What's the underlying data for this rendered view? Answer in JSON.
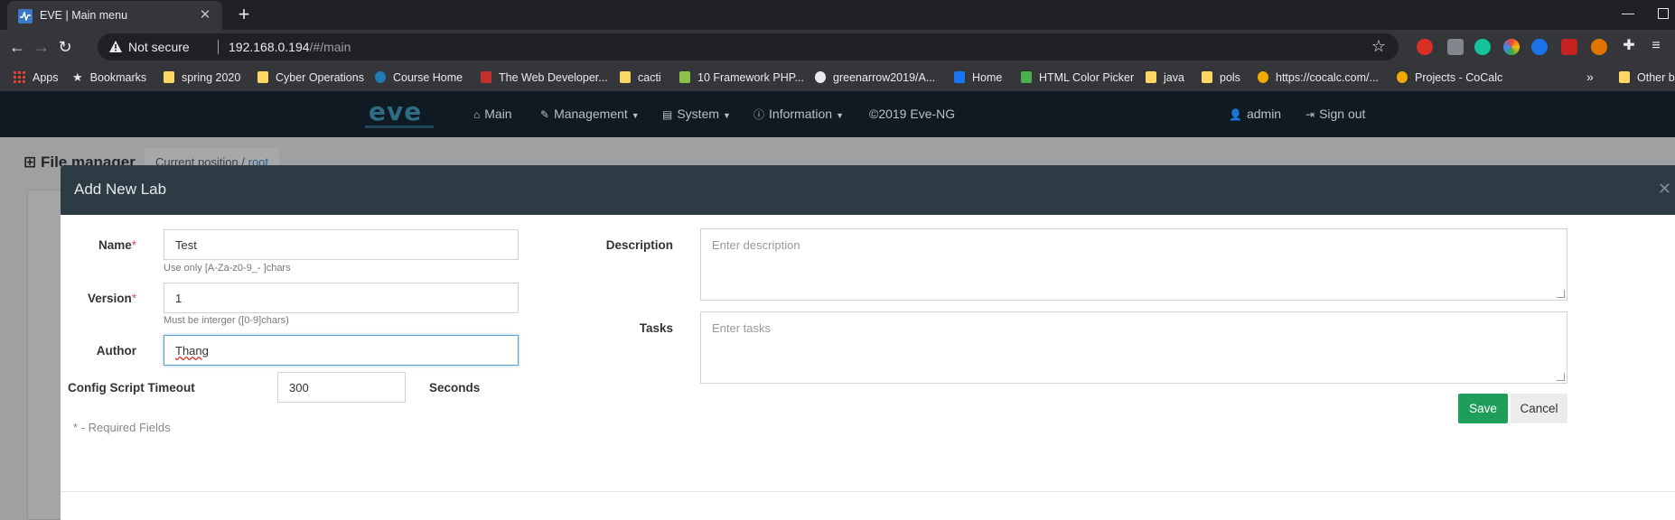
{
  "browser": {
    "tab_title": "EVE | Main menu",
    "tab_close": "✕",
    "new_tab": "+",
    "security_label": "Not secure",
    "url_host": "192.168.0.194",
    "url_path": "/#/main",
    "bookmarks": [
      {
        "label": "Apps",
        "icon": "apps-grid"
      },
      {
        "label": "Bookmarks",
        "icon": "star"
      },
      {
        "label": "spring 2020",
        "icon": "folder"
      },
      {
        "label": "Cyber Operations",
        "icon": "folder"
      },
      {
        "label": "Course Home",
        "icon": "site"
      },
      {
        "label": "The Web Developer...",
        "icon": "site"
      },
      {
        "label": "cacti",
        "icon": "folder"
      },
      {
        "label": "10 Framework PHP...",
        "icon": "site"
      },
      {
        "label": "greenarrow2019/A...",
        "icon": "github"
      },
      {
        "label": "Home",
        "icon": "facebook"
      },
      {
        "label": "HTML Color Picker",
        "icon": "site"
      },
      {
        "label": "java",
        "icon": "folder"
      },
      {
        "label": "pols",
        "icon": "folder"
      },
      {
        "label": "https://cocalc.com/...",
        "icon": "site"
      },
      {
        "label": "Projects - CoCalc",
        "icon": "site"
      },
      {
        "label": "Other b",
        "icon": "folder"
      }
    ],
    "overflow": "»"
  },
  "app_nav": {
    "logo_text": "eve",
    "items": {
      "main": "Main",
      "management": "Management",
      "system": "System",
      "information": "Information",
      "copyright": "©2019 Eve-NG",
      "user": "admin",
      "signout": "Sign out"
    }
  },
  "background": {
    "file_manager_title": "File manager",
    "current_position_label": "Current position",
    "current_position_root": "root"
  },
  "modal": {
    "title": "Add New Lab",
    "close": "✕",
    "name": {
      "label": "Name",
      "value": "Test",
      "hint": "Use only [A-Za-z0-9_- ]chars"
    },
    "version": {
      "label": "Version",
      "value": "1",
      "hint": "Must be interger ([0-9]chars)"
    },
    "author": {
      "label": "Author",
      "value": "Thang"
    },
    "timeout": {
      "label": "Config Script Timeout",
      "value": "300",
      "unit": "Seconds"
    },
    "required_marker": "*",
    "required_note": "* - Required Fields",
    "description": {
      "label": "Description",
      "placeholder": "Enter description"
    },
    "tasks": {
      "label": "Tasks",
      "placeholder": "Enter tasks"
    },
    "save": "Save",
    "cancel": "Cancel"
  },
  "colors": {
    "navbar": "#0f1a22",
    "modal_header": "#2d3c44",
    "save": "#1e9e5a",
    "required": "#d9534f"
  }
}
